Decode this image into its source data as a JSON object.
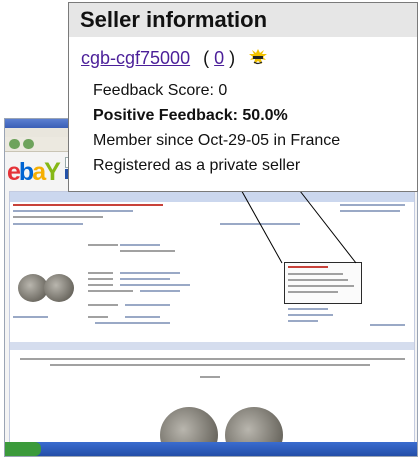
{
  "seller_panel": {
    "title": "Seller information",
    "username": "cgb-cgf75000",
    "feedback_count": "0",
    "open_paren": "(",
    "close_paren": ")",
    "feedback_score": "Feedback Score: 0",
    "positive_feedback": "Positive Feedback: 50.0%",
    "member_since": "Member since Oct-29-05 in France",
    "registration": "Registered as a private seller",
    "icon": "sunglasses-icon"
  },
  "background_screenshot": {
    "logo": {
      "e": "e",
      "b": "b",
      "a": "a",
      "y": "Y"
    },
    "colors": {
      "titlebar": "#3a5fb6",
      "taskbar": "#244ea8",
      "start": "#3b9a3b"
    }
  }
}
